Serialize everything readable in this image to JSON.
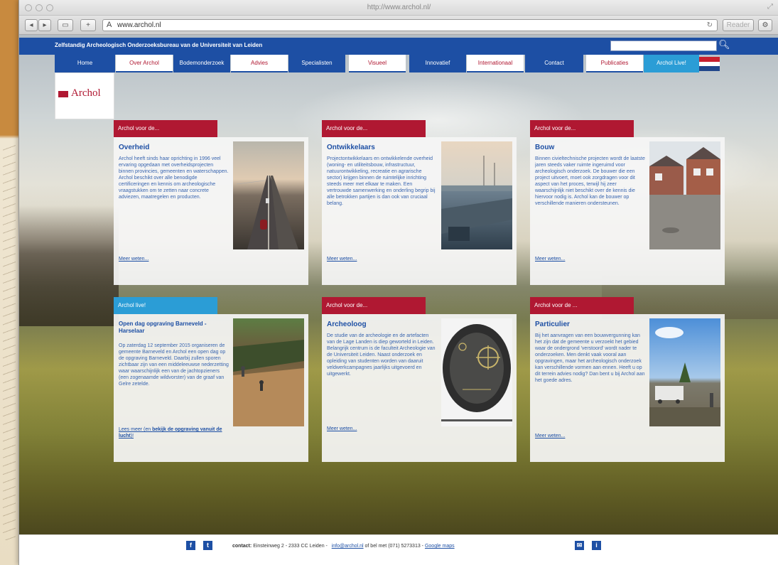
{
  "browser": {
    "window_title": "http://www.archol.nl/",
    "address": "www.archol.nl",
    "reader_label": "Reader"
  },
  "site": {
    "tagline": "Zelfstandig Archeologisch Onderzoeksbureau van de Universiteit van Leiden",
    "search_placeholder": "",
    "logo_text": "Archol",
    "nav": [
      {
        "label": "Home",
        "style": "blue"
      },
      {
        "label": "Over Archol",
        "style": "white"
      },
      {
        "label": "Bodemonderzoek",
        "style": "blue"
      },
      {
        "label": "Advies",
        "style": "white"
      },
      {
        "label": "Specialisten",
        "style": "blue"
      },
      {
        "label": "Visueel",
        "style": "white"
      },
      {
        "label": "Innovatief",
        "style": "blue"
      },
      {
        "label": "Internationaal",
        "style": "white"
      },
      {
        "label": "Contact",
        "style": "blue"
      },
      {
        "label": "Publicaties",
        "style": "white"
      },
      {
        "label": "Archol Live!",
        "style": "cyan"
      }
    ],
    "cards": [
      {
        "tab": "Archol voor de...",
        "title": "Overheid",
        "text": "Archol heeft sinds haar oprichting in 1996 veel ervaring opgedaan met overheidsprojecten binnen provincies, gemeenten en waterschappen. Archol beschikt over alle benodigde certificeringen en kennis om archeologische vraagstukken om te zetten naar concrete adviezen, maatregelen en producten.",
        "more": "Meer weten..."
      },
      {
        "tab": "Archol voor de...",
        "title": "Ontwikkelaars",
        "text": "Projectontwikkelaars en ontwikkelende overheid (woning- en utiliteitsbouw, infrastructuur, natuurontwikkeling, recreatie en agrarische sector) krijgen binnen de ruimtelijke inrichting steeds meer met elkaar te maken. Een vertrouwde samenwerking en onderling begrip bij alle betrokken partijen is dan ook van cruciaal belang.",
        "more": "Meer weten..."
      },
      {
        "tab": "Archol voor de...",
        "title": "Bouw",
        "text": "Binnen civieltechnische projecten wordt de laatste jaren steeds vaker ruimte ingeruimd voor archeologisch onderzoek. De bouwer die een project uitvoert, moet ook zorgdragen voor dit aspect van het proces, terwijl hij zeer waarschijnlijk niet beschikt over de kennis die hiervoor nodig is. Archol kan de bouwer op verschillende manieren ondersteunen.",
        "more": "Meer weten..."
      },
      {
        "tab": "Archol live!",
        "title": "Open dag opgraving Barneveld - Harselaar",
        "text": "Op zaterdag 12 september 2015 organiseren de gemeente Barneveld en Archol een open dag op de opgraving Barneveld. Daarbij zullen sporen zichtbaar zijn van een middeleeuwse nederzetting waar waarschijnlijk een van de jachtopzieners (een zogenaamde wildvorster) van de graaf van Gelre zetelde.",
        "more_prefix": "Lees meer (en ",
        "more_bold": "bekijk de opgraving vanuit de lucht",
        "more_suffix": ")!"
      },
      {
        "tab": "Archol voor de...",
        "title": "Archeoloog",
        "text": "De studie van de archeologie en de artefacten van de Lage Landen is diep geworteld in Leiden. Belangrijk centrum is de faculteit Archeologie van de Universiteit Leiden. Naast onderzoek en opleiding van studenten worden van daaruit veldwerkcampagnes jaarlijks uitgevoerd en uitgewerkt.",
        "more": "Meer weten..."
      },
      {
        "tab": "Archol voor de ...",
        "title": "Particulier",
        "text": "Bij het aanvragen van een bouwvergunning kan het zijn dat de gemeente u verzoekt het gebied waar de ondergrond 'verstoord' wordt nader te onderzoeken. Men denkt vaak vooral aan opgravingen, maar het archeologisch onderzoek kan verschillende vormen aan ennen. Heeft u op dit terrein advies nodig? Dan bent u bij Archol aan het goede adres.",
        "more": "Meer weten..."
      }
    ],
    "footer": {
      "facebook": "f",
      "twitter": "t",
      "contact_label": "contact:",
      "address": "Einsteinweg 2 - 2333 CC Leiden -",
      "email": "info@archol.nl",
      "phone": "of bel met (071) 5273313 -",
      "maps": "Google maps",
      "info": "i"
    },
    "colors": {
      "blue": "#1d4fa4",
      "red": "#b01832",
      "cyan": "#2b9dd6"
    }
  }
}
